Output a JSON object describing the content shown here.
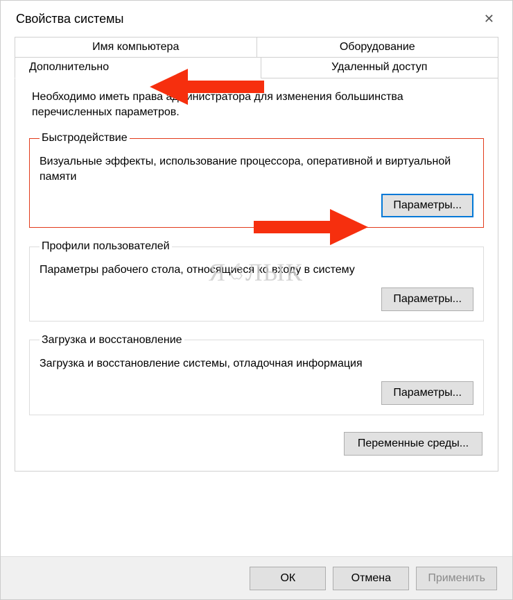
{
  "window": {
    "title": "Свойства системы"
  },
  "tabs": {
    "row1": [
      {
        "label": "Имя компьютера"
      },
      {
        "label": "Оборудование"
      }
    ],
    "row2": [
      {
        "label": "Дополнительно",
        "active": true
      },
      {
        "label": "Удаленный доступ"
      }
    ]
  },
  "content": {
    "intro": "Необходимо иметь права администратора для изменения большинства перечисленных параметров."
  },
  "groups": {
    "performance": {
      "legend": "Быстродействие",
      "desc": "Визуальные эффекты, использование процессора, оперативной и виртуальной памяти",
      "button": "Параметры..."
    },
    "profiles": {
      "legend": "Профили пользователей",
      "desc": "Параметры рабочего стола, относящиеся ко входу в систему",
      "button": "Параметры..."
    },
    "startup": {
      "legend": "Загрузка и восстановление",
      "desc": "Загрузка и восстановление системы, отладочная информация",
      "button": "Параметры..."
    }
  },
  "env_button": "Переменные среды...",
  "footer": {
    "ok": "ОК",
    "cancel": "Отмена",
    "apply": "Применить"
  },
  "watermark": "ЯБЛЫК",
  "annotations": {
    "arrow_color": "#f62f0e"
  }
}
